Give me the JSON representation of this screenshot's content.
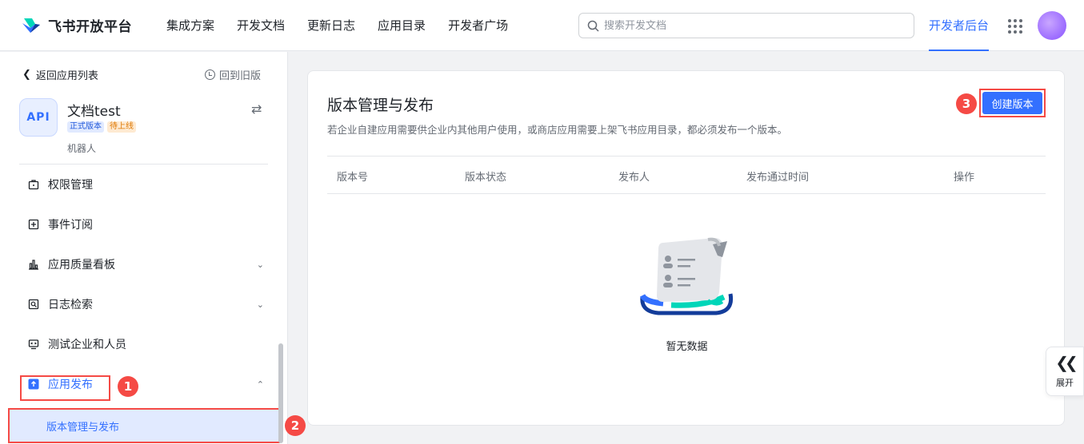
{
  "header": {
    "logo_text": "飞书开放平台",
    "nav": [
      "集成方案",
      "开发文档",
      "更新日志",
      "应用目录",
      "开发者广场"
    ],
    "search_placeholder": "搜索开发文档",
    "console_label": "开发者后台"
  },
  "sidebar": {
    "back_label": "返回应用列表",
    "old_version_label": "回到旧版",
    "app": {
      "icon_text": "API",
      "name": "文档test",
      "badge_release": "正式版本",
      "badge_pending": "待上线",
      "type": "机器人"
    },
    "menu": [
      {
        "label": "权限管理",
        "icon": "permission-icon"
      },
      {
        "label": "事件订阅",
        "icon": "event-icon"
      },
      {
        "label": "应用质量看板",
        "icon": "chart-icon"
      },
      {
        "label": "日志检索",
        "icon": "log-search-icon"
      },
      {
        "label": "测试企业和人员",
        "icon": "test-icon"
      },
      {
        "label": "应用发布",
        "icon": "publish-icon"
      }
    ],
    "sub_item": "版本管理与发布"
  },
  "steps": [
    "1",
    "2",
    "3"
  ],
  "main": {
    "title": "版本管理与发布",
    "description": "若企业自建应用需要供企业内其他用户使用，或商店应用需要上架飞书应用目录，都必须发布一个版本。",
    "create_button": "创建版本",
    "columns": [
      "版本号",
      "版本状态",
      "发布人",
      "发布通过时间",
      "操作"
    ],
    "empty_text": "暂无数据"
  },
  "expand": {
    "label": "展开"
  },
  "colors": {
    "accent": "#3370ff",
    "highlight": "#f54a45"
  }
}
